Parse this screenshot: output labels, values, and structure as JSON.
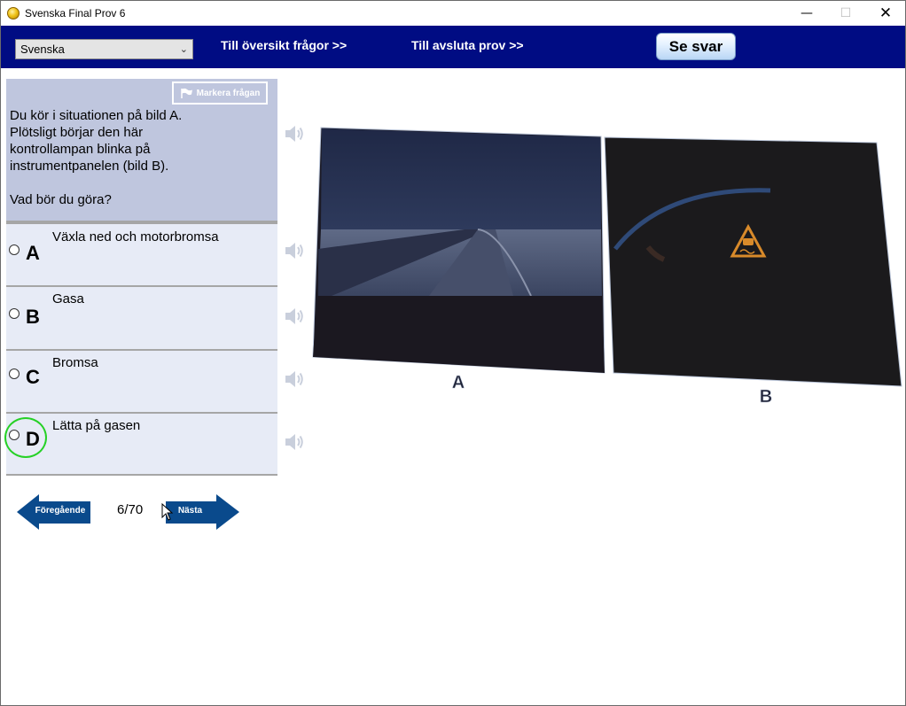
{
  "window": {
    "title": "Svenska Final Prov 6",
    "minimize_glyph": "—",
    "maximize_glyph": "☐",
    "close_glyph": "✕"
  },
  "toolbar": {
    "language": "Svenska",
    "overview_link": "Till översikt frågor >>",
    "finish_link": "Till avsluta prov  >>",
    "show_answer": "Se svar"
  },
  "question": {
    "mark_label": "Markera frågan",
    "text": "Du kör i situationen på bild A.\nPlötsligt börjar den här\nkontrollampan blinka på\ninstrumentpanelen (bild B).\n\nVad bör du göra?"
  },
  "answers": [
    {
      "letter": "A",
      "text": "Växla ned och motorbromsa"
    },
    {
      "letter": "B",
      "text": "Gasa"
    },
    {
      "letter": "C",
      "text": "Bromsa"
    },
    {
      "letter": "D",
      "text": "Lätta på gasen"
    }
  ],
  "navigation": {
    "prev_label": "Föregående",
    "next_label": "Nästa",
    "counter": "6/70"
  },
  "image": {
    "label_a": "A",
    "label_b": "B"
  },
  "icons": {
    "app": "app-coin-icon",
    "flag": "flag-icon",
    "speaker": "speaker-icon",
    "warning": "skid-warning-icon",
    "cursor": "mouse-pointer-icon"
  },
  "colors": {
    "topbar": "#000c83",
    "question_bg": "#bfc6de",
    "answer_bg": "#e7ebf6",
    "arrow": "#0a4a8c",
    "focus_ring": "#26d126"
  }
}
